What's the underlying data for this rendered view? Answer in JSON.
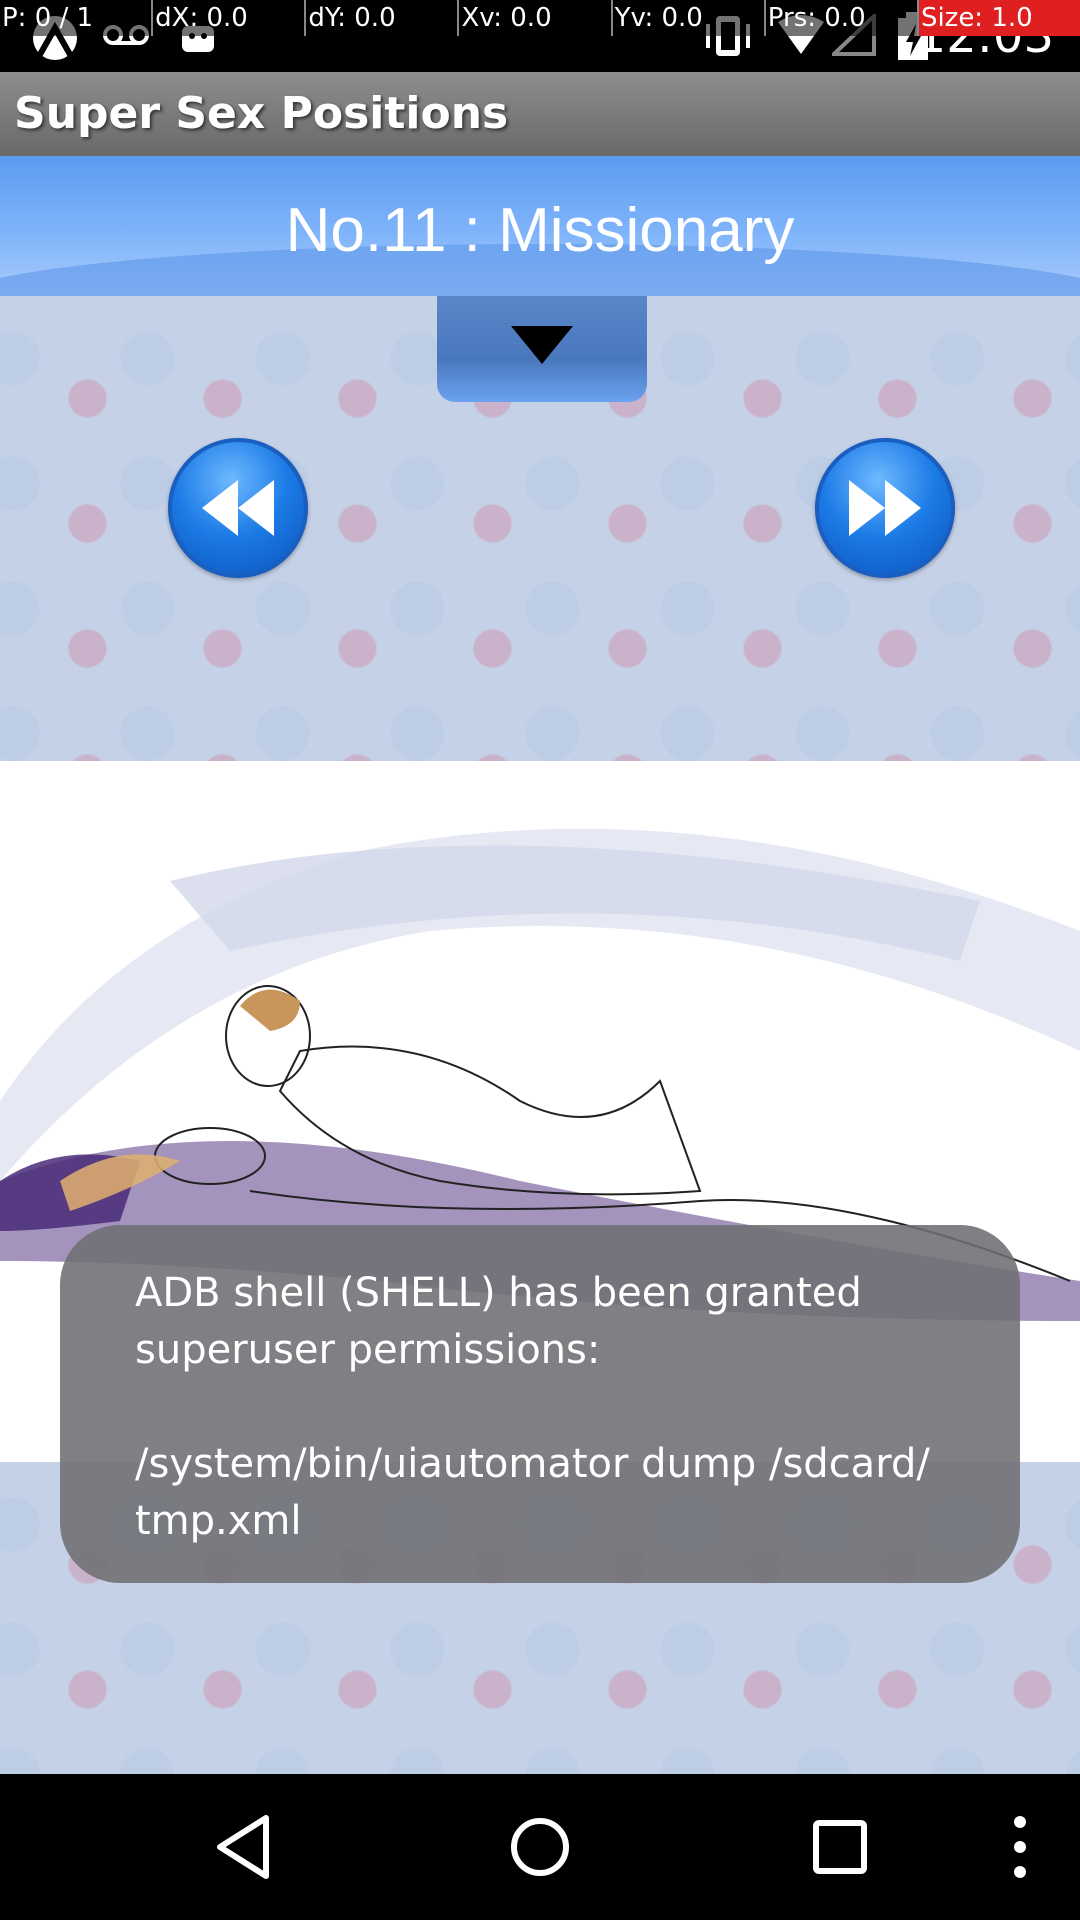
{
  "status_bar": {
    "clock": "12:03",
    "icons": [
      "android-debug-icon",
      "voicemail-icon",
      "android-icon",
      "vibrate-icon",
      "wifi-icon",
      "signal-icon",
      "battery-charging-icon"
    ]
  },
  "pointer_location": {
    "cells": [
      "P: 0 / 1",
      "dX: 0.0",
      "dY: 0.0",
      "Xv: 0.0",
      "Yv: 0.0",
      "Prs: 0.0",
      "Size: 1.0"
    ]
  },
  "action_bar": {
    "title": "Super Sex Positions"
  },
  "header": {
    "position_title": "No.11 : Missionary"
  },
  "toast": {
    "message": "ADB shell (SHELL) has been granted\nsuperuser permissions:\n\n/system/bin/uiautomator dump /sdcard/\ntmp.xml"
  },
  "colors": {
    "banner": "#6fa8f5",
    "button_blue": "#1c7be6",
    "toast_bg": "#6e6e73"
  }
}
